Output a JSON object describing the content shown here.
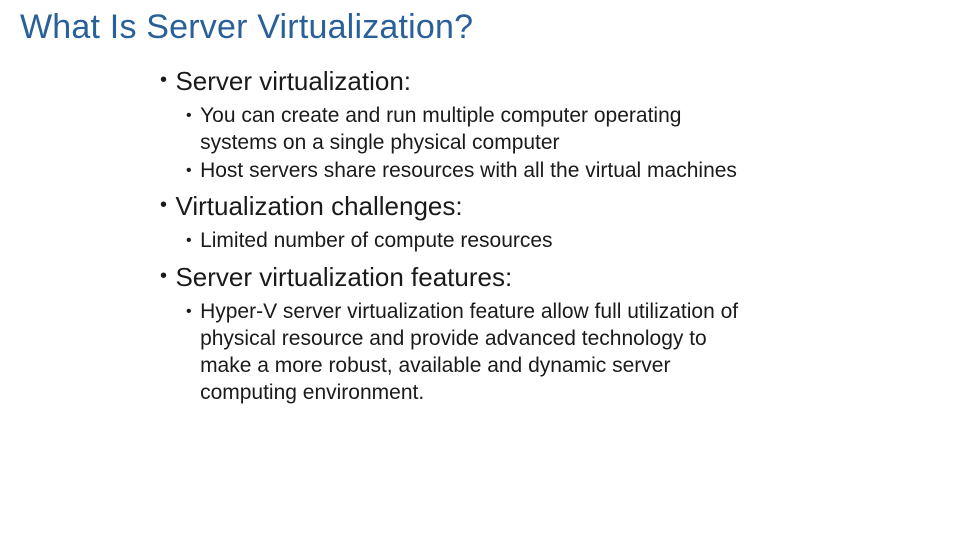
{
  "slide": {
    "title": "What Is Server Virtualization?",
    "sections": [
      {
        "heading": "Server virtualization:",
        "items": [
          "You can create and run multiple computer operating systems on a single physical computer",
          "Host servers share resources with all the virtual machines"
        ]
      },
      {
        "heading": "Virtualization challenges:",
        "items": [
          "Limited number of compute resources"
        ]
      },
      {
        "heading": "Server virtualization features:",
        "items": [
          "Hyper-V server virtualization feature allow full utilization of physical resource and provide advanced technology to make a more robust, available and dynamic server computing environment."
        ]
      }
    ]
  }
}
